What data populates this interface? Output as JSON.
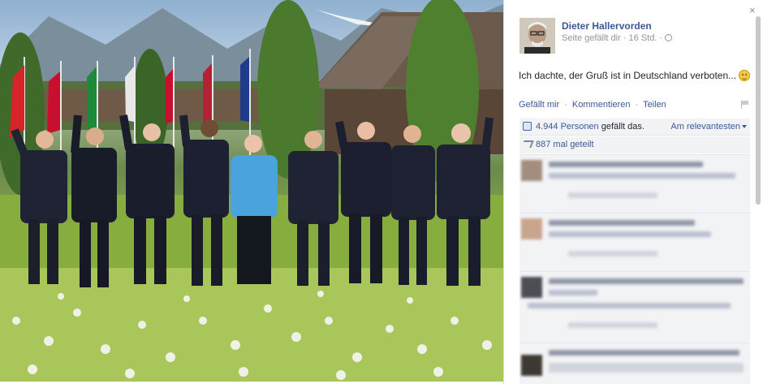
{
  "window": {
    "close_label": "×"
  },
  "post": {
    "author": "Dieter Hallervorden",
    "meta_text": "Seite gefällt dir · 16 Std. ·",
    "text": "Ich dachte, der Gruß ist in Deutschland verboten...",
    "emoji": "smiley-icon"
  },
  "actions": {
    "like": "Gefällt mir",
    "separator": "·",
    "comment": "Kommentieren",
    "share": "Teilen"
  },
  "stats": {
    "likes_count": "4.944 Personen",
    "likes_suffix": "gefällt das.",
    "sort_label": "Am relevantesten",
    "shares": "887 mal geteilt"
  },
  "colors": {
    "link_blue": "#3b5998",
    "meta_gray": "#90949c",
    "box_bg": "#f2f3f5",
    "jacket_blue": "#4aa3dc"
  },
  "icons": [
    "close-icon",
    "globe-icon",
    "flag-icon",
    "thumbs-up-icon",
    "share-icon",
    "smiley-icon",
    "caret-down-icon"
  ]
}
